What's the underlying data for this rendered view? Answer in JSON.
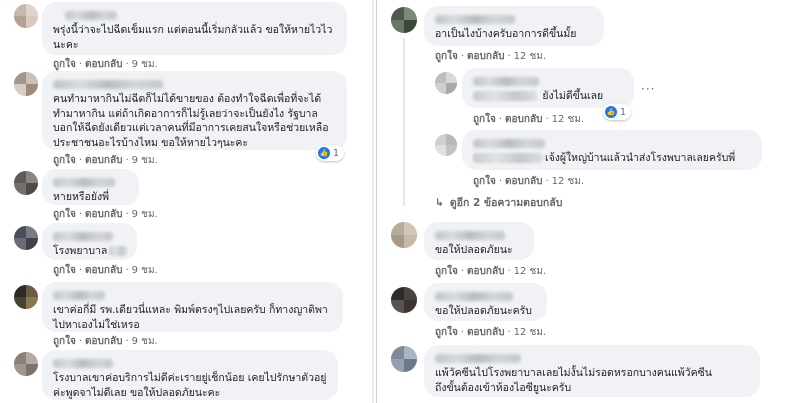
{
  "labels": {
    "like": "ถูกใจ",
    "reply": "ตอบกลับ"
  },
  "left_comments": [
    {
      "text": [
        "พรุ่งนี้ว่าจะไปฉีดเข็มแรก แต่ตอนนี้เริ่มกลัวแล้ว ขอให้หายไวไว",
        "นะคะ"
      ],
      "time": "9 ชม."
    },
    {
      "text": [
        "คนทำมาหากินไม่ฉีดก็ไม่ได้ขายของ ต้องทำใจฉีดเพื่อที่จะได้",
        "ทำมาหากิน แต่ถ้าเกิดอาการก็ไม่รู้เลยว่าจะเป็นยังไง รัฐบาล",
        "บอกให้ฉีดยังเดียวแต่เวลาคนที่มีอาการเคยสนใจหรือช่วยเหลือ",
        "ประชาชนอะไรบ้างไหม ขอให้หายไวๆนะคะ"
      ],
      "time": "9 ชม.",
      "reactions": "1"
    },
    {
      "text": [
        "หายหรือยังพี่"
      ],
      "time": "9 ชม."
    },
    {
      "text": [
        "โรงพยาบาล"
      ],
      "time": "9 ชม."
    },
    {
      "text": [
        "เขาค่อกี่มี รพ.เดียวนี่แหละ พิมพ์ตรงๆไปเลยครับ ก็ทางญาติพา",
        "ไปหาเองไม่ใช่เหรอ"
      ],
      "time": "9 ชม."
    },
    {
      "text": [
        "โรงบาลเขาค่อบริการไม่ดีค่ะเรายยู่เช็กน้อย เคยไปรักษาตัวอยู่",
        "ค่ะพูดจาไม่ดีเลย ขอให้ปลอดภัยนะคะ"
      ],
      "time": ""
    }
  ],
  "right_comments": [
    {
      "text": [
        "อาเป็นไงบ้างครับอาการดีขึ้นมั้ย"
      ],
      "time": "12 ชม."
    },
    {
      "text": [
        "ยังไม่ดีขึ้นเลย"
      ],
      "time": "12 ชม.",
      "reactions": "1"
    },
    {
      "text": [
        "เจ้งผู้ใหญ่บ้านแล้วนำส่งโรงพบาลเลยครับพี่"
      ],
      "time": "12 ชม."
    },
    {
      "text": [
        "ขอให้ปลอดภัยนะ"
      ],
      "time": "12 ชม."
    },
    {
      "text": [
        "ขอให้ปลอดภัยนะครับ"
      ],
      "time": "12 ชม."
    },
    {
      "text": [
        "แพ้วัคซีนไปโรงพยาบาลเลยไม่งั้นไม่รอดหรอกบางคนแพ้วัคซีน",
        "ถึงขั้นต้องเข้าห้องไอซียูนะครับ"
      ],
      "time": ""
    }
  ],
  "more_replies": "ดูอีก 2 ข้อความตอบกลับ",
  "more_menu": "···"
}
